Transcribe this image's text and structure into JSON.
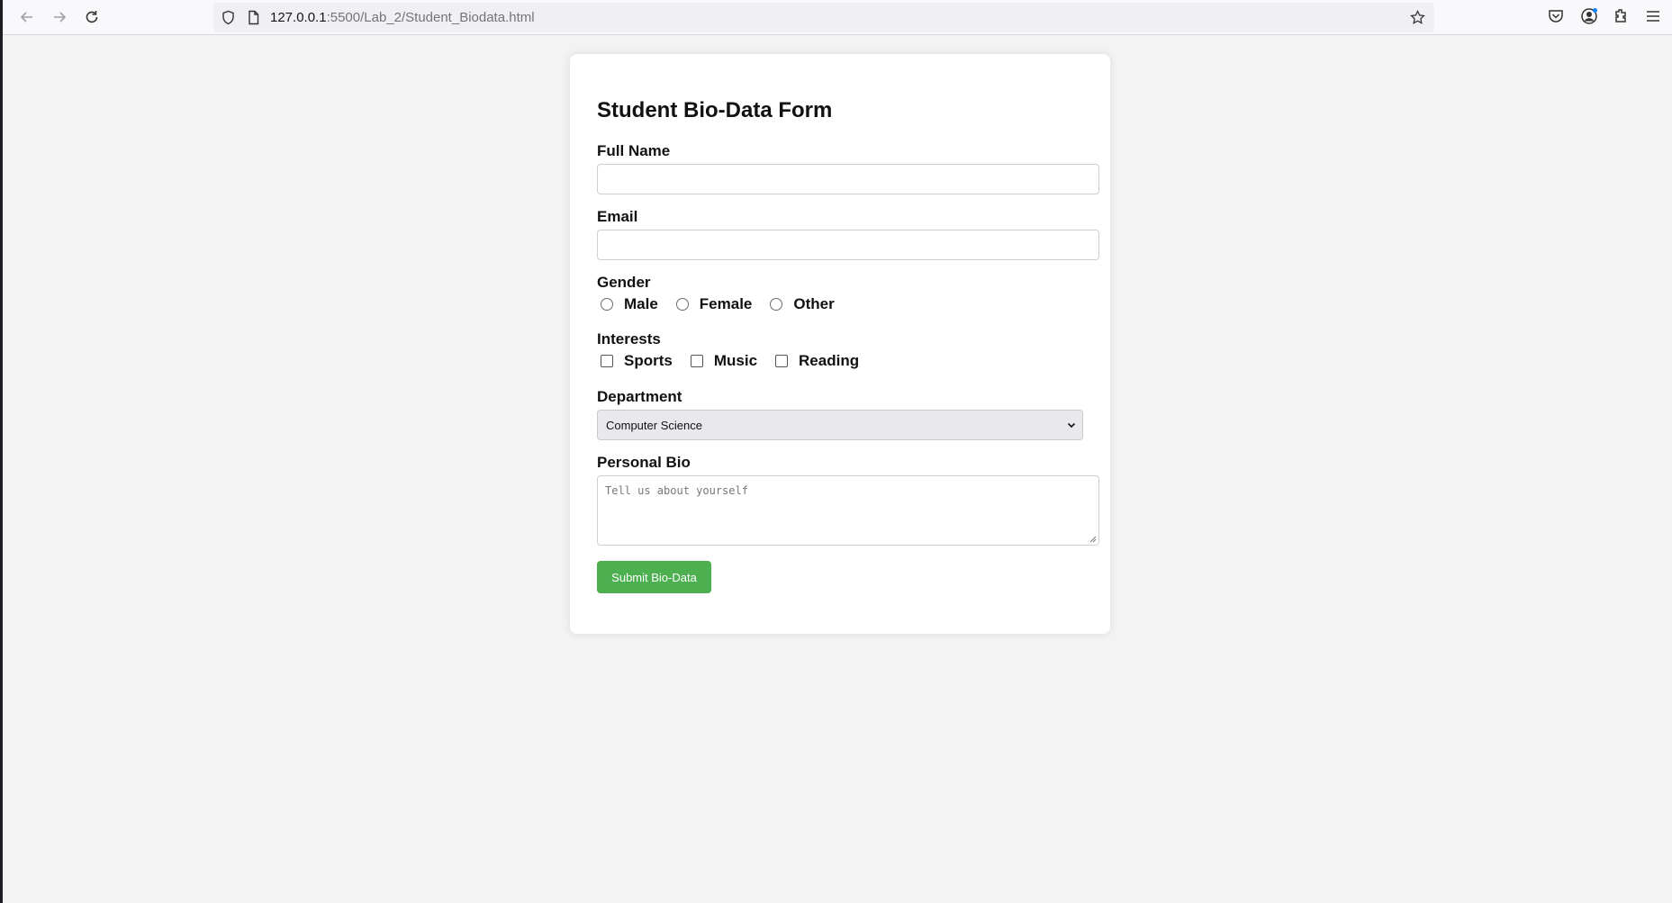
{
  "browser": {
    "url_host": "127.0.0.1",
    "url_path": ":5500/Lab_2/Student_Biodata.html"
  },
  "form": {
    "title": "Student Bio-Data Form",
    "full_name_label": "Full Name",
    "email_label": "Email",
    "gender_label": "Gender",
    "gender_options": [
      "Male",
      "Female",
      "Other"
    ],
    "interests_label": "Interests",
    "interest_options": [
      "Sports",
      "Music",
      "Reading"
    ],
    "department_label": "Department",
    "department_selected": "Computer Science",
    "bio_label": "Personal Bio",
    "bio_placeholder": "Tell us about yourself",
    "submit_label": "Submit Bio-Data"
  },
  "colors": {
    "submit_bg": "#4caf50",
    "page_bg": "#f3f3f3"
  }
}
